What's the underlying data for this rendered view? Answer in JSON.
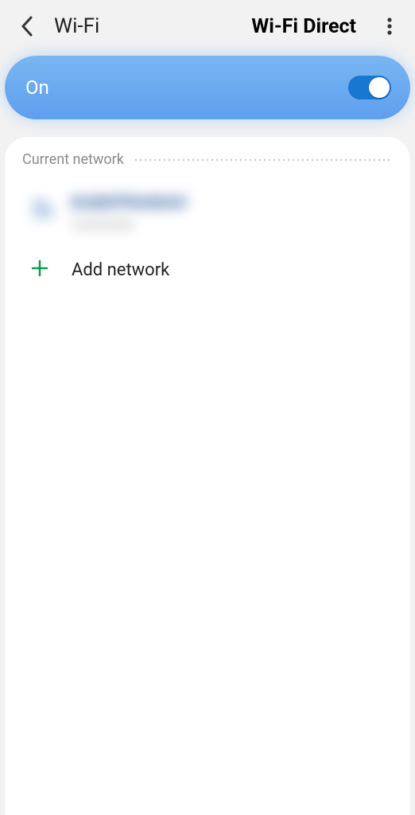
{
  "header": {
    "title": "Wi-Fi",
    "wifi_direct": "Wi-Fi Direct"
  },
  "toggle": {
    "label": "On",
    "state": "on"
  },
  "section": {
    "title": "Current network"
  },
  "network": {
    "name": "KABIPRANAV",
    "status": "Connected"
  },
  "add": {
    "label": "Add network"
  }
}
